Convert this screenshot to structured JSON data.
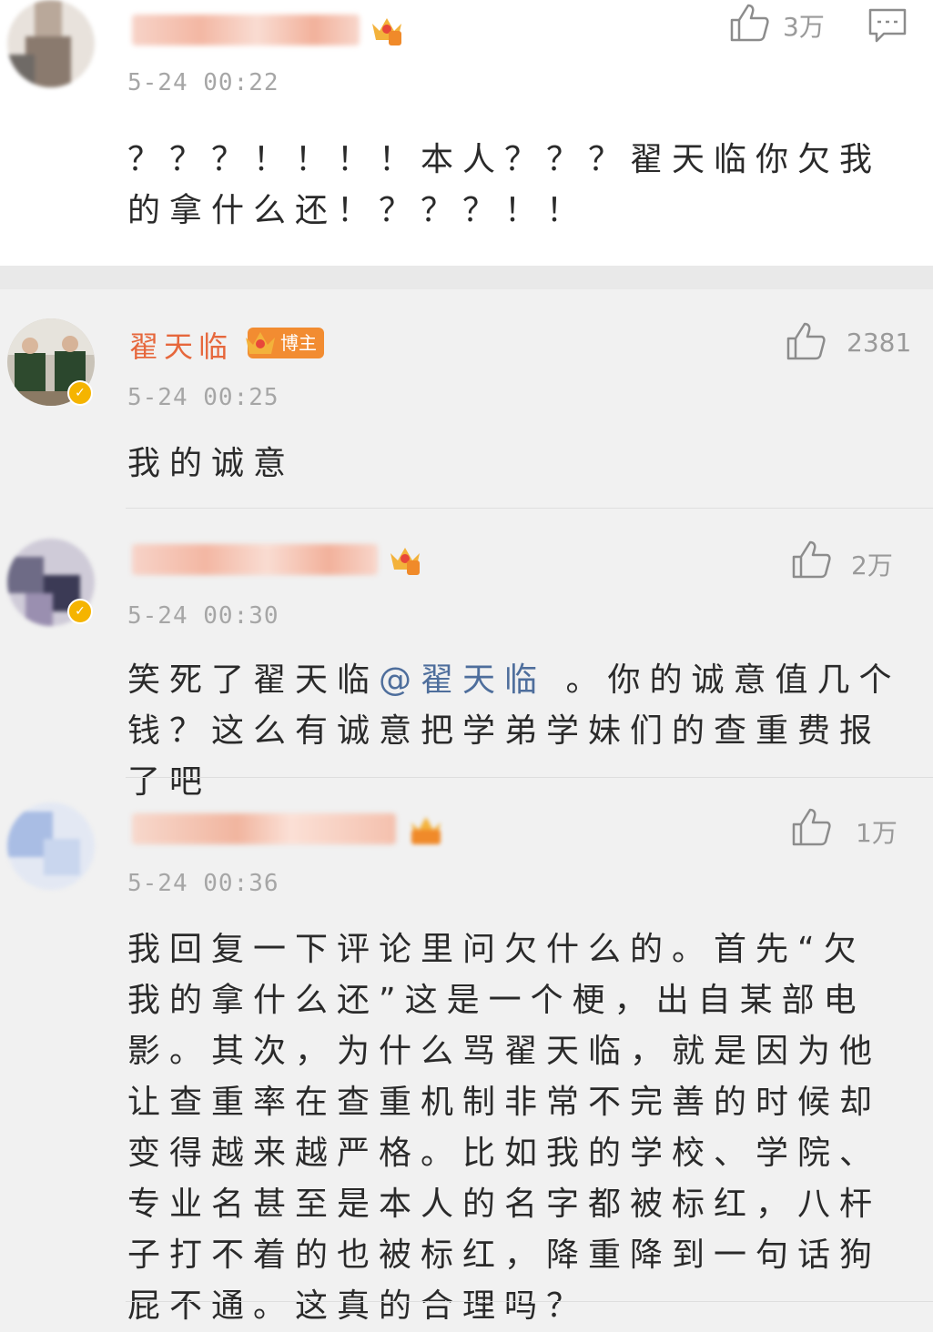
{
  "comments": [
    {
      "time": "5-24 00:22",
      "content": "？？？！！！！本人？？？翟天临你欠我的拿什么还！？？？！！",
      "likes": "3万"
    },
    {
      "name": "翟天临",
      "host_label": "博主",
      "time": "5-24 00:25",
      "content": "我的诚意",
      "likes": "2381"
    },
    {
      "time": "5-24 00:30",
      "content_before": "笑死了翟天临",
      "mention": "@翟天临",
      "content_after": " 。你的诚意值几个钱？这么有诚意把学弟学妹们的查重费报了吧",
      "likes": "2万"
    },
    {
      "time": "5-24 00:36",
      "content": "我回复一下评论里问欠什么的。首先“欠我的拿什么还”这是一个梗，出自某部电影。其次，为什么骂翟天临，就是因为他让查重率在查重机制非常不完善的时候却变得越来越严格。比如我的学校、学院、专业名甚至是本人的名字都被标红，八杆子打不着的也被标红，降重降到一句话狗屁不通。这真的合理吗？",
      "likes": "1万"
    }
  ],
  "icons": {
    "like": "thumbs-up-icon",
    "comment": "comment-icon",
    "crown": "crown-icon",
    "verified": "verified-icon"
  },
  "colors": {
    "host_name": "#e6673c",
    "host_tag": "#f28c31",
    "mention": "#4e6e9c",
    "meta": "#a6a6a6"
  }
}
